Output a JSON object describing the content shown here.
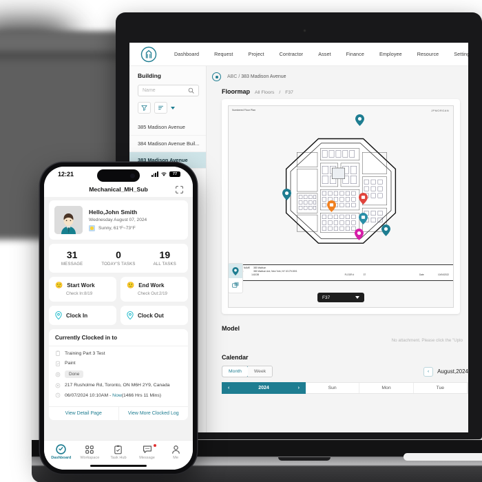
{
  "web": {
    "nav": [
      {
        "label": "Dashboard"
      },
      {
        "label": "Request"
      },
      {
        "label": "Project"
      },
      {
        "label": "Contractor"
      },
      {
        "label": "Asset"
      },
      {
        "label": "Finance"
      },
      {
        "label": "Employee"
      },
      {
        "label": "Resource"
      },
      {
        "label": "Setting"
      }
    ],
    "sidebar": {
      "title": "Building",
      "search_placeholder": "Name",
      "items": [
        {
          "label": "385 Madison Avenue",
          "active": false
        },
        {
          "label": "384 Madison Avenue Buil...",
          "active": false
        },
        {
          "label": "383 Madison Avenue",
          "active": true
        }
      ]
    },
    "breadcrumb": {
      "root": "ABC",
      "sep": "/",
      "current": "383 Madison Avenue"
    },
    "floormap": {
      "title": "Floormap",
      "sub_all": "All Floors",
      "sub_sep": "/",
      "sub_floor": "F37",
      "plan_label": "Numbered Floor Plan",
      "brand": "JPMORGAN",
      "titleblock": {
        "k1": "BUILDING NAME",
        "v1": "383 Madison",
        "k2": "ADDRESS",
        "v2": "383 Madison Ave, New York, NY 10179-0001",
        "k3": "TAB #",
        "v3": "14103B",
        "k4": "FLOOR #",
        "v4": "37",
        "k5": "Date",
        "v5": "10/04/2022"
      },
      "floor_select": "F37"
    },
    "model": {
      "title": "Model",
      "empty_note": "No attachment. Please click the \"Uplo"
    },
    "calendar": {
      "title": "Calendar",
      "view_month": "Month",
      "view_week": "Week",
      "prev": "‹",
      "month_label": "August,2024",
      "year": "2024",
      "year_prev": "‹",
      "year_next": "›",
      "dow": [
        "Sun",
        "Mon",
        "Tue"
      ]
    }
  },
  "phone": {
    "status": {
      "time": "12:21",
      "battery": "77"
    },
    "header_title": "Mechanical_MH_Sub",
    "greeting": {
      "name": "Hello,John Smith",
      "date": "Wednesday August 07, 2024",
      "weather": "Sunny, 61°F~73°F"
    },
    "stats": [
      {
        "value": "31",
        "label": "MESSAGE"
      },
      {
        "value": "0",
        "label": "TODAY'S TASKS"
      },
      {
        "value": "19",
        "label": "ALL TASKS"
      }
    ],
    "actions": [
      {
        "label": "Start Work",
        "sub": "Check In:8/19",
        "emoji": "🙂"
      },
      {
        "label": "End Work",
        "sub": "Check Out:2/19",
        "emoji": "🙂"
      },
      {
        "label": "Clock In",
        "sub": "",
        "emoji": ""
      },
      {
        "label": "Clock Out",
        "sub": "",
        "emoji": ""
      }
    ],
    "clocked": {
      "title": "Currently Clocked in to",
      "task": "Training Part 3 Test",
      "job": "Paint",
      "status": "Done",
      "address": "217 Rusholme Rd, Toronto, ON M6H 2Y9, Canada",
      "time_start": "06/07/2024 10:10AM - ",
      "time_now": "Now",
      "time_dur": "(1466 Hrs 11 Mins)",
      "link_detail": "View Detail Page",
      "link_log": "View More Clocked Log"
    },
    "tabs": [
      {
        "label": "Dashboard",
        "active": true
      },
      {
        "label": "Workspace",
        "active": false
      },
      {
        "label": "Task Hub",
        "active": false
      },
      {
        "label": "Message",
        "active": false
      },
      {
        "label": "Me",
        "active": false
      }
    ]
  },
  "colors": {
    "accent": "#1e7d91",
    "pin_teal": "#1e7d91",
    "pin_red": "#e0443c",
    "pin_orange": "#f08020",
    "pin_magenta": "#d61fa8"
  }
}
